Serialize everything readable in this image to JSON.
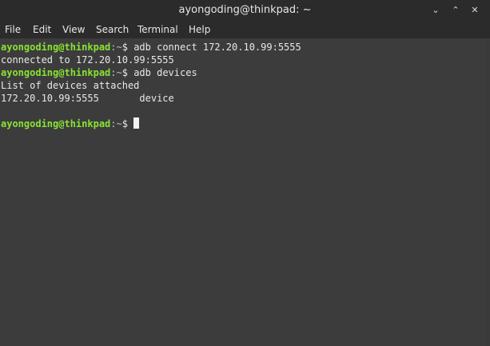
{
  "window": {
    "title": "ayongoding@thinkpad: ~",
    "min_glyph": "⌄",
    "max_glyph": "⌃",
    "close_glyph": "✕"
  },
  "menu": {
    "items": [
      "File",
      "Edit",
      "View",
      "Search",
      "Terminal",
      "Help"
    ]
  },
  "terminal": {
    "prompt_user": "ayongoding@thinkpad",
    "prompt_path": ":~",
    "prompt_symbol": "$",
    "lines": [
      {
        "type": "prompt",
        "command": "adb connect 172.20.10.99:5555"
      },
      {
        "type": "output",
        "text": "connected to 172.20.10.99:5555"
      },
      {
        "type": "prompt",
        "command": "adb devices"
      },
      {
        "type": "output",
        "text": "List of devices attached"
      },
      {
        "type": "output",
        "text": "172.20.10.99:5555       device"
      },
      {
        "type": "output",
        "text": ""
      },
      {
        "type": "prompt",
        "command": ""
      }
    ]
  },
  "colors": {
    "prompt_user": "#8ae234",
    "text": "#e8e8e8",
    "background": "#3c3c3c",
    "titlebar": "#2b2b2b"
  }
}
